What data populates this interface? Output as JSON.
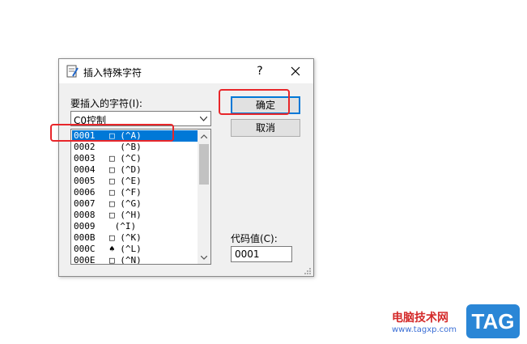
{
  "dialog": {
    "title": "插入特殊字符",
    "help": "?",
    "label_chars": "要插入的字符(I):",
    "combo_value": "C0控制",
    "ok": "确定",
    "cancel": "取消",
    "label_code": "代码值(C):",
    "code_value": "0001",
    "list": [
      {
        "code": "0001",
        "char": "□ (^A)",
        "selected": true
      },
      {
        "code": "0002",
        "char": "  (^B)",
        "selected": false
      },
      {
        "code": "0003",
        "char": "□ (^C)",
        "selected": false
      },
      {
        "code": "0004",
        "char": "□ (^D)",
        "selected": false
      },
      {
        "code": "0005",
        "char": "□ (^E)",
        "selected": false
      },
      {
        "code": "0006",
        "char": "□ (^F)",
        "selected": false
      },
      {
        "code": "0007",
        "char": "□ (^G)",
        "selected": false
      },
      {
        "code": "0008",
        "char": "□ (^H)",
        "selected": false
      },
      {
        "code": "0009",
        "char": " (^I)",
        "selected": false
      },
      {
        "code": "000B",
        "char": "□ (^K)",
        "selected": false
      },
      {
        "code": "000C",
        "char": "♠ (^L)",
        "selected": false
      },
      {
        "code": "000E",
        "char": "□ (^N)",
        "selected": false
      }
    ]
  },
  "watermark": {
    "site": "电脑技术网",
    "url": "www.tagxp.com",
    "tag": "TAG"
  },
  "colors": {
    "selection": "#0078d7",
    "highlight": "#e8262a",
    "tag_bg": "#2a86d6"
  }
}
